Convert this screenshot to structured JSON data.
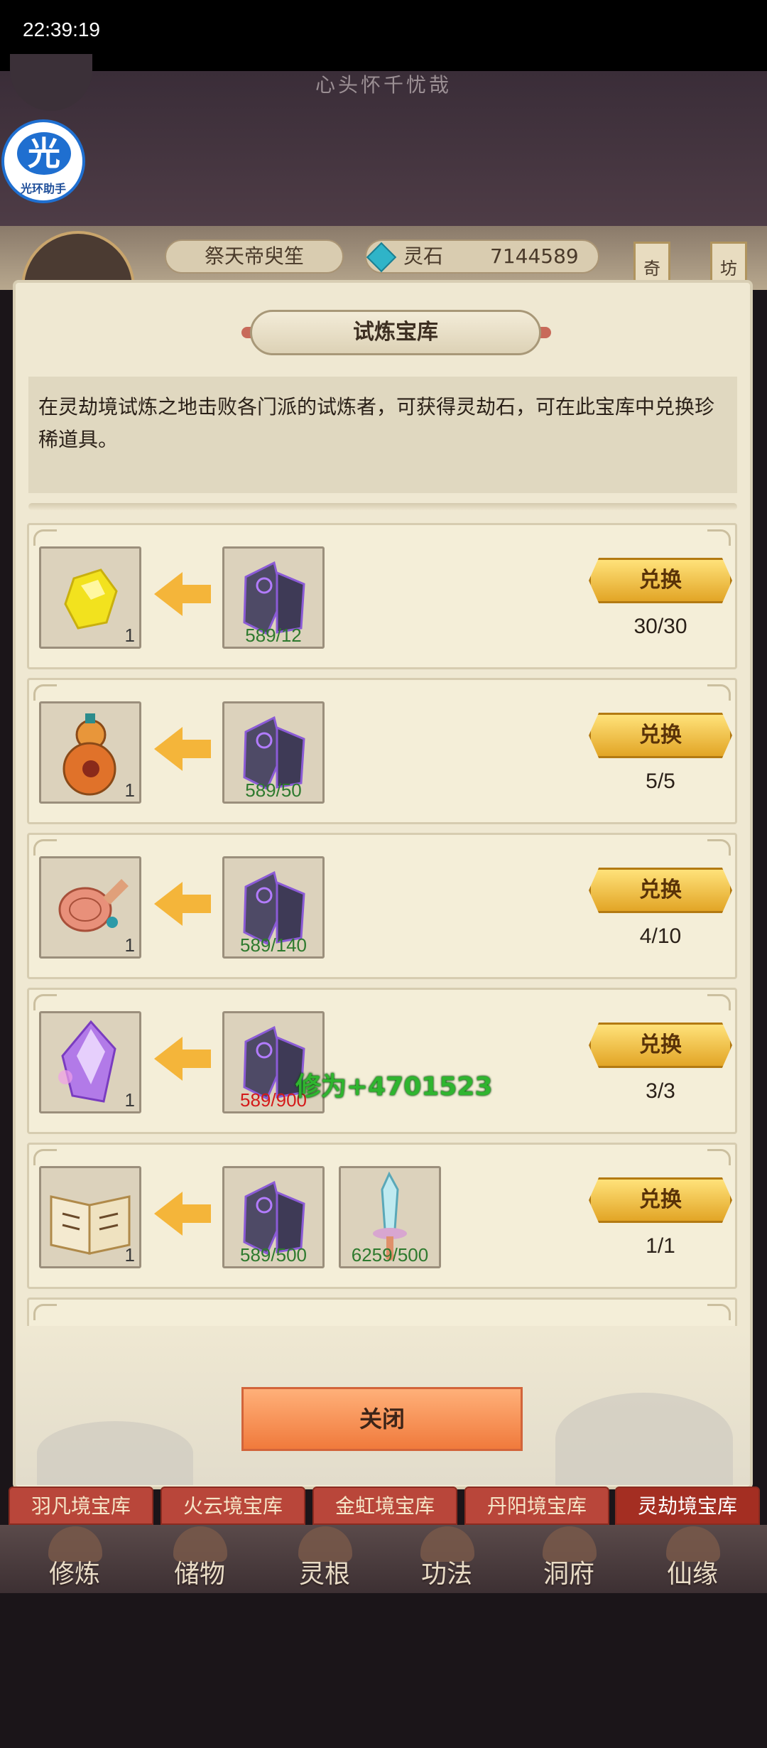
{
  "status_bar": {
    "time": "22:39:19"
  },
  "header": {
    "subtitle": "心头怀千忧哉",
    "helper_logo": {
      "glyph": "光",
      "label": "光环助手"
    },
    "player_name": "祭天帝臾笙",
    "stone_label": "灵石",
    "stone_value": "7144589",
    "side_tags": [
      "奇",
      "坊"
    ]
  },
  "dialog": {
    "title": "试炼宝库",
    "description": "在灵劫境试炼之地击败各门派的试炼者，可获得灵劫石，可在此宝库中兑换珍稀道具。",
    "exchange_label": "兑换",
    "close_label": "关闭",
    "floating_text": "修为+4701523",
    "items": [
      {
        "reward_icon": "yellow-gem-icon",
        "reward_qty": "1",
        "costs": [
          {
            "icon": "spirit-stone-icon",
            "text": "589/12",
            "color": "green"
          }
        ],
        "count": "30/30"
      },
      {
        "reward_icon": "gourd-icon",
        "reward_qty": "1",
        "costs": [
          {
            "icon": "spirit-stone-icon",
            "text": "589/50",
            "color": "green"
          }
        ],
        "count": "5/5"
      },
      {
        "reward_icon": "scroll-icon",
        "reward_qty": "1",
        "costs": [
          {
            "icon": "spirit-stone-icon",
            "text": "589/140",
            "color": "green"
          }
        ],
        "count": "4/10"
      },
      {
        "reward_icon": "purple-crystal-icon",
        "reward_qty": "1",
        "costs": [
          {
            "icon": "spirit-stone-icon",
            "text": "589/900",
            "color": "red"
          }
        ],
        "count": "3/3"
      },
      {
        "reward_icon": "book-icon",
        "reward_qty": "1",
        "costs": [
          {
            "icon": "spirit-stone-icon",
            "text": "589/500",
            "color": "green"
          },
          {
            "icon": "sword-icon",
            "text": "6259/500",
            "color": "green"
          }
        ],
        "count": "1/1"
      }
    ]
  },
  "tabs": [
    "羽凡境宝库",
    "火云境宝库",
    "金虹境宝库",
    "丹阳境宝库",
    "灵劫境宝库"
  ],
  "active_tab": 4,
  "nav": [
    "修炼",
    "储物",
    "灵根",
    "功法",
    "洞府",
    "仙缘"
  ],
  "colors": {
    "cost_green": "#2e7a2e",
    "cost_red": "#d41a1a",
    "button_gold": "#e2a526",
    "close_orange": "#f07a3c",
    "tab_red": "#b9463a"
  }
}
